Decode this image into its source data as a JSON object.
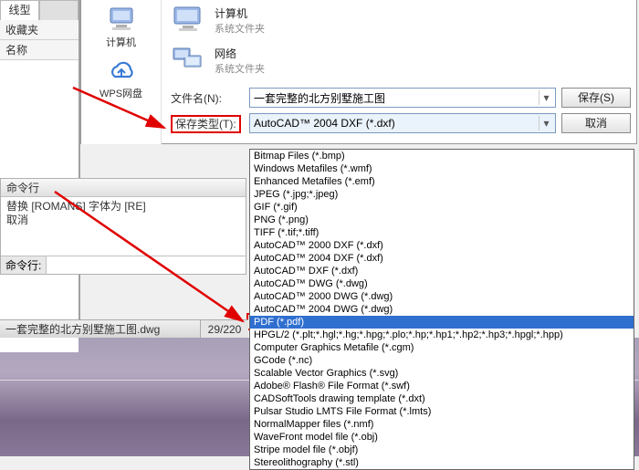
{
  "left_panel": {
    "tab_active": "线型",
    "tab_inactive": "",
    "row_favorites": "收藏夹",
    "row_name": "名称"
  },
  "places": {
    "computer": "计算机",
    "wps": "WPS网盘"
  },
  "locations": {
    "computer": {
      "title": "计算机",
      "sub": "系统文件夹"
    },
    "network": {
      "title": "网络",
      "sub": "系统文件夹"
    }
  },
  "form": {
    "filename_label": "文件名(N):",
    "filename_value": "一套完整的北方别墅施工图",
    "filetype_label": "保存类型(T):",
    "filetype_value": "AutoCAD™ 2004 DXF (*.dxf)",
    "save_btn": "保存(S)",
    "cancel_btn": "取消"
  },
  "dropdown": [
    "Bitmap Files (*.bmp)",
    "Windows Metafiles (*.wmf)",
    "Enhanced Metafiles (*.emf)",
    "JPEG (*.jpg;*.jpeg)",
    "GIF (*.gif)",
    "PNG (*.png)",
    "TIFF (*.tif;*.tiff)",
    "AutoCAD™ 2000 DXF (*.dxf)",
    "AutoCAD™ 2004 DXF (*.dxf)",
    "AutoCAD™ DXF (*.dxf)",
    "AutoCAD™ DWG (*.dwg)",
    "AutoCAD™ 2000 DWG (*.dwg)",
    "AutoCAD™ 2004 DWG (*.dwg)",
    "PDF (*.pdf)",
    "HPGL/2 (*.plt;*.hgl;*.hg;*.hpg;*.plo;*.hp;*.hp1;*.hp2;*.hp3;*.hpgl;*.hpp)",
    "Computer Graphics Metafile (*.cgm)",
    "GCode (*.nc)",
    "Scalable Vector Graphics (*.svg)",
    "Adobe® Flash® File Format (*.swf)",
    "CADSoftTools drawing template (*.dxt)",
    "Pulsar Studio LMTS File Format (*.lmts)",
    "NormalMapper files (*.nmf)",
    "WaveFront model file (*.obj)",
    "Stripe model file (*.objf)",
    "Stereolithography (*.stl)"
  ],
  "dropdown_selected_index": 13,
  "cmd": {
    "title": "命令行",
    "line1": "替换 [ROMANS] 字体为 [RE]",
    "line2": "取消",
    "prompt": "命令行:"
  },
  "status": {
    "file": "一套完整的北方别墅施工图.dwg",
    "page": "29/220"
  }
}
